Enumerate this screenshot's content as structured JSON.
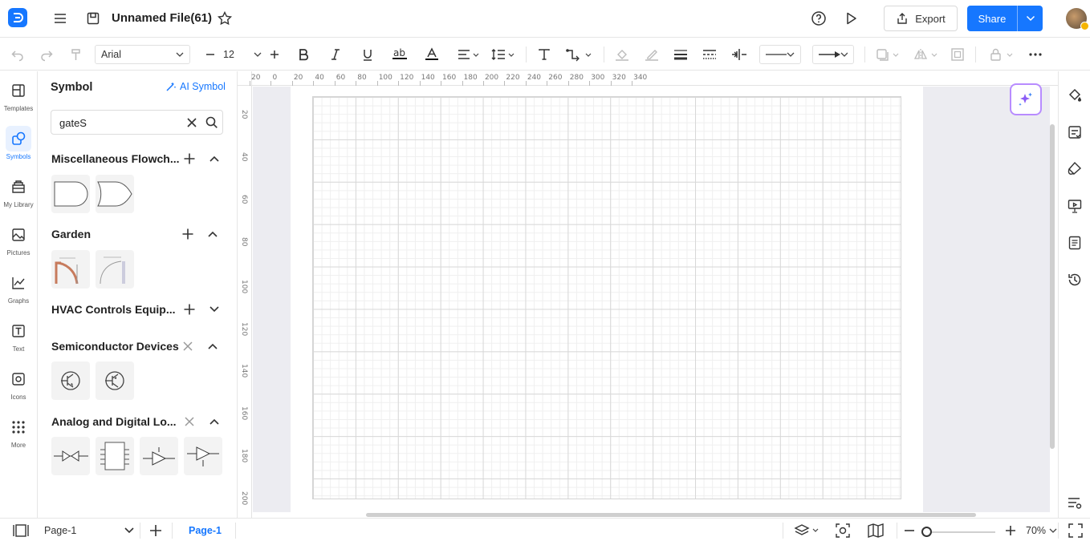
{
  "header": {
    "file_title": "Unnamed File(61)",
    "export_label": "Export",
    "share_label": "Share"
  },
  "toolbar": {
    "font_family": "Arial",
    "font_size": "12"
  },
  "rail": {
    "items": [
      {
        "label": "Templates",
        "icon": "templates-icon"
      },
      {
        "label": "Symbols",
        "icon": "symbols-icon",
        "active": true
      },
      {
        "label": "My Library",
        "icon": "library-icon"
      },
      {
        "label": "Pictures",
        "icon": "pictures-icon"
      },
      {
        "label": "Graphs",
        "icon": "graphs-icon"
      },
      {
        "label": "Text",
        "icon": "text-icon"
      },
      {
        "label": "Icons",
        "icon": "icons-icon"
      },
      {
        "label": "More",
        "icon": "more-icon"
      }
    ]
  },
  "panel": {
    "title": "Symbol",
    "ai_symbol_label": "AI Symbol",
    "search_value": "gateS",
    "categories": [
      {
        "name": "Miscellaneous Flowch...",
        "action": "add",
        "expanded": true
      },
      {
        "name": "Garden",
        "action": "add",
        "expanded": true
      },
      {
        "name": "HVAC Controls Equip...",
        "action": "add",
        "expanded": false
      },
      {
        "name": "Semiconductor Devices",
        "action": "remove",
        "expanded": true
      },
      {
        "name": "Analog and Digital Lo...",
        "action": "remove",
        "expanded": true
      }
    ]
  },
  "rulers": {
    "horizontal": [
      "20",
      "0",
      "20",
      "40",
      "60",
      "80",
      "100",
      "120",
      "140",
      "160",
      "180",
      "200",
      "220",
      "240",
      "260",
      "280",
      "300",
      "320",
      "340"
    ],
    "vertical": [
      "20",
      "40",
      "60",
      "80",
      "100",
      "120",
      "140",
      "160",
      "180",
      "200"
    ]
  },
  "statusbar": {
    "page_select": "Page-1",
    "page_tab": "Page-1",
    "zoom": "70%"
  },
  "colors": {
    "accent": "#1677ff",
    "ai_border": "#b88cff"
  }
}
